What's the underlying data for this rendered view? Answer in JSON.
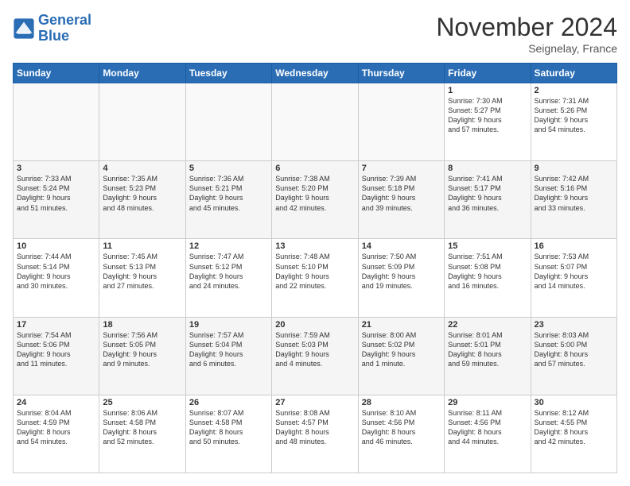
{
  "header": {
    "logo_line1": "General",
    "logo_line2": "Blue",
    "month_title": "November 2024",
    "location": "Seignelay, France"
  },
  "days_of_week": [
    "Sunday",
    "Monday",
    "Tuesday",
    "Wednesday",
    "Thursday",
    "Friday",
    "Saturday"
  ],
  "weeks": [
    [
      {
        "day": "",
        "info": ""
      },
      {
        "day": "",
        "info": ""
      },
      {
        "day": "",
        "info": ""
      },
      {
        "day": "",
        "info": ""
      },
      {
        "day": "",
        "info": ""
      },
      {
        "day": "1",
        "info": "Sunrise: 7:30 AM\nSunset: 5:27 PM\nDaylight: 9 hours\nand 57 minutes."
      },
      {
        "day": "2",
        "info": "Sunrise: 7:31 AM\nSunset: 5:26 PM\nDaylight: 9 hours\nand 54 minutes."
      }
    ],
    [
      {
        "day": "3",
        "info": "Sunrise: 7:33 AM\nSunset: 5:24 PM\nDaylight: 9 hours\nand 51 minutes."
      },
      {
        "day": "4",
        "info": "Sunrise: 7:35 AM\nSunset: 5:23 PM\nDaylight: 9 hours\nand 48 minutes."
      },
      {
        "day": "5",
        "info": "Sunrise: 7:36 AM\nSunset: 5:21 PM\nDaylight: 9 hours\nand 45 minutes."
      },
      {
        "day": "6",
        "info": "Sunrise: 7:38 AM\nSunset: 5:20 PM\nDaylight: 9 hours\nand 42 minutes."
      },
      {
        "day": "7",
        "info": "Sunrise: 7:39 AM\nSunset: 5:18 PM\nDaylight: 9 hours\nand 39 minutes."
      },
      {
        "day": "8",
        "info": "Sunrise: 7:41 AM\nSunset: 5:17 PM\nDaylight: 9 hours\nand 36 minutes."
      },
      {
        "day": "9",
        "info": "Sunrise: 7:42 AM\nSunset: 5:16 PM\nDaylight: 9 hours\nand 33 minutes."
      }
    ],
    [
      {
        "day": "10",
        "info": "Sunrise: 7:44 AM\nSunset: 5:14 PM\nDaylight: 9 hours\nand 30 minutes."
      },
      {
        "day": "11",
        "info": "Sunrise: 7:45 AM\nSunset: 5:13 PM\nDaylight: 9 hours\nand 27 minutes."
      },
      {
        "day": "12",
        "info": "Sunrise: 7:47 AM\nSunset: 5:12 PM\nDaylight: 9 hours\nand 24 minutes."
      },
      {
        "day": "13",
        "info": "Sunrise: 7:48 AM\nSunset: 5:10 PM\nDaylight: 9 hours\nand 22 minutes."
      },
      {
        "day": "14",
        "info": "Sunrise: 7:50 AM\nSunset: 5:09 PM\nDaylight: 9 hours\nand 19 minutes."
      },
      {
        "day": "15",
        "info": "Sunrise: 7:51 AM\nSunset: 5:08 PM\nDaylight: 9 hours\nand 16 minutes."
      },
      {
        "day": "16",
        "info": "Sunrise: 7:53 AM\nSunset: 5:07 PM\nDaylight: 9 hours\nand 14 minutes."
      }
    ],
    [
      {
        "day": "17",
        "info": "Sunrise: 7:54 AM\nSunset: 5:06 PM\nDaylight: 9 hours\nand 11 minutes."
      },
      {
        "day": "18",
        "info": "Sunrise: 7:56 AM\nSunset: 5:05 PM\nDaylight: 9 hours\nand 9 minutes."
      },
      {
        "day": "19",
        "info": "Sunrise: 7:57 AM\nSunset: 5:04 PM\nDaylight: 9 hours\nand 6 minutes."
      },
      {
        "day": "20",
        "info": "Sunrise: 7:59 AM\nSunset: 5:03 PM\nDaylight: 9 hours\nand 4 minutes."
      },
      {
        "day": "21",
        "info": "Sunrise: 8:00 AM\nSunset: 5:02 PM\nDaylight: 9 hours\nand 1 minute."
      },
      {
        "day": "22",
        "info": "Sunrise: 8:01 AM\nSunset: 5:01 PM\nDaylight: 8 hours\nand 59 minutes."
      },
      {
        "day": "23",
        "info": "Sunrise: 8:03 AM\nSunset: 5:00 PM\nDaylight: 8 hours\nand 57 minutes."
      }
    ],
    [
      {
        "day": "24",
        "info": "Sunrise: 8:04 AM\nSunset: 4:59 PM\nDaylight: 8 hours\nand 54 minutes."
      },
      {
        "day": "25",
        "info": "Sunrise: 8:06 AM\nSunset: 4:58 PM\nDaylight: 8 hours\nand 52 minutes."
      },
      {
        "day": "26",
        "info": "Sunrise: 8:07 AM\nSunset: 4:58 PM\nDaylight: 8 hours\nand 50 minutes."
      },
      {
        "day": "27",
        "info": "Sunrise: 8:08 AM\nSunset: 4:57 PM\nDaylight: 8 hours\nand 48 minutes."
      },
      {
        "day": "28",
        "info": "Sunrise: 8:10 AM\nSunset: 4:56 PM\nDaylight: 8 hours\nand 46 minutes."
      },
      {
        "day": "29",
        "info": "Sunrise: 8:11 AM\nSunset: 4:56 PM\nDaylight: 8 hours\nand 44 minutes."
      },
      {
        "day": "30",
        "info": "Sunrise: 8:12 AM\nSunset: 4:55 PM\nDaylight: 8 hours\nand 42 minutes."
      }
    ]
  ]
}
